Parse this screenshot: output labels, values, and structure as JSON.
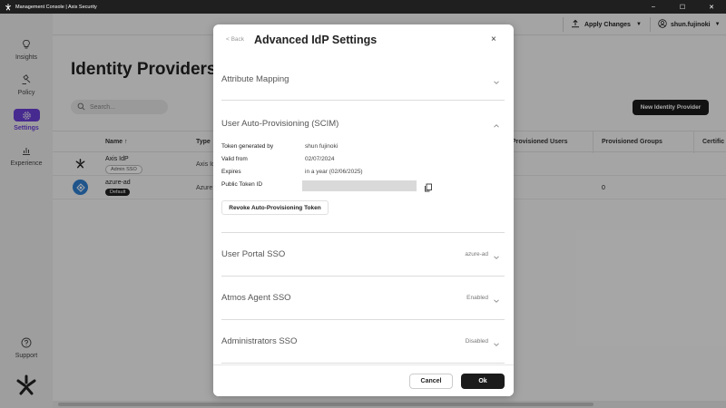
{
  "window": {
    "title": "Management Console | Axis Security",
    "controls": {
      "minimize": "–",
      "maximize": "☐",
      "close": "✕"
    }
  },
  "sidebar": {
    "items": [
      {
        "label": "Insights",
        "icon": "lightbulb-icon"
      },
      {
        "label": "Policy",
        "icon": "gavel-icon"
      },
      {
        "label": "Settings",
        "icon": "gear-icon",
        "active": true
      },
      {
        "label": "Experience",
        "icon": "bar-chart-icon"
      }
    ],
    "support": {
      "label": "Support",
      "icon": "help-circle-icon"
    }
  },
  "header": {
    "apply_changes_label": "Apply Changes",
    "username": "shun.fujinoki"
  },
  "page": {
    "title": "Identity Providers",
    "search_placeholder": "Search...",
    "new_idp_label": "New Identity Provider",
    "columns": [
      "Name",
      "Type",
      "Provisioned Users",
      "Provisioned Groups",
      "Certific"
    ],
    "rows": [
      {
        "name": "Axis IdP",
        "badge": "Admin SSO",
        "type": "Axis Id",
        "users": "",
        "groups": ""
      },
      {
        "name": "azure-ad",
        "badge": "Default",
        "type": "Azure",
        "users": "",
        "groups": "0"
      }
    ]
  },
  "modal": {
    "back_label": "< Back",
    "title": "Advanced IdP Settings",
    "close": "×",
    "sections": {
      "attribute_mapping": {
        "title": "Attribute Mapping"
      },
      "scim": {
        "title": "User Auto-Provisioning (SCIM)",
        "token_generated_by_label": "Token generated by",
        "token_generated_by": "shun fujinoki",
        "valid_from_label": "Valid from",
        "valid_from": "02/07/2024",
        "expires_label": "Expires",
        "expires": "in a year (02/06/2025)",
        "public_token_id_label": "Public Token ID",
        "revoke_label": "Revoke Auto-Provisioning Token"
      },
      "user_portal_sso": {
        "title": "User Portal SSO",
        "value": "azure-ad"
      },
      "atmos_agent_sso": {
        "title": "Atmos Agent SSO",
        "value": "Enabled"
      },
      "administrators_sso": {
        "title": "Administrators SSO",
        "value": "Disabled"
      }
    },
    "footer": {
      "cancel_label": "Cancel",
      "ok_label": "Ok"
    }
  },
  "colors": {
    "accent": "#6b3fd6",
    "dark_button": "#1b1b1b",
    "titlebar": "#1f1f1f",
    "azure_logo": "#2f7fd0"
  }
}
